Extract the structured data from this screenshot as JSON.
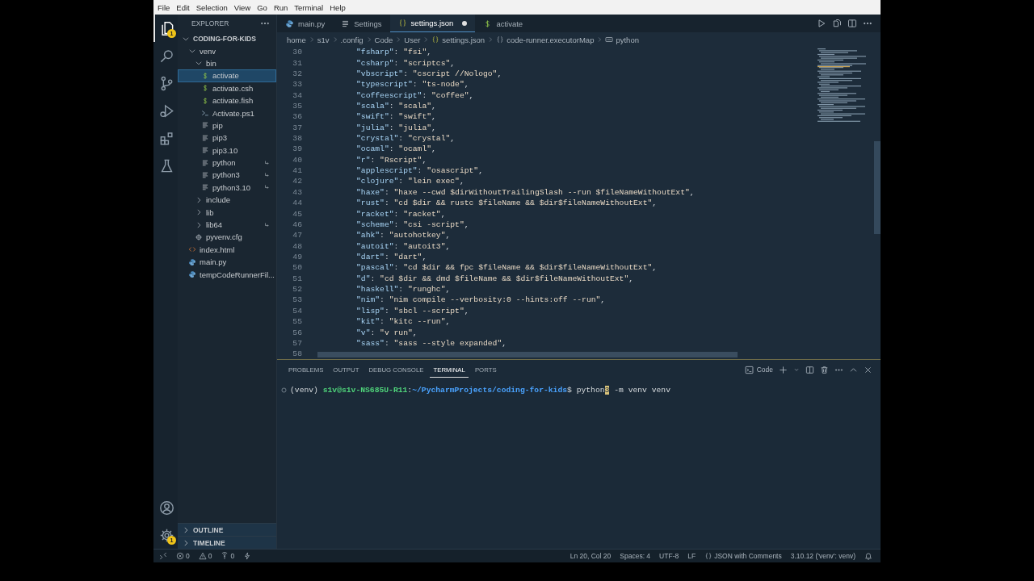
{
  "menu": [
    "File",
    "Edit",
    "Selection",
    "View",
    "Go",
    "Run",
    "Terminal",
    "Help"
  ],
  "activity_bar": {
    "top": [
      {
        "kind": "files",
        "selected": true,
        "badge": "1"
      },
      {
        "kind": "search",
        "selected": false
      },
      {
        "kind": "branch",
        "selected": false
      },
      {
        "kind": "debug",
        "selected": false
      },
      {
        "kind": "extensions",
        "selected": false
      },
      {
        "kind": "flask",
        "selected": false
      }
    ],
    "bottom": [
      {
        "kind": "account"
      },
      {
        "kind": "gear",
        "badge": "1"
      }
    ]
  },
  "explorer": {
    "title": "EXPLORER",
    "root": {
      "label": "CODING-FOR-KIDS",
      "expanded": true,
      "children": [
        {
          "label": "venv",
          "kind": "folder",
          "expanded": true,
          "selected": false,
          "children": [
            {
              "label": "bin",
              "kind": "folder",
              "expanded": true,
              "selected": false,
              "children": [
                {
                  "label": "activate",
                  "kind": "shell",
                  "selected": true,
                  "symlink": false
                },
                {
                  "label": "activate.csh",
                  "kind": "shell",
                  "selected": false,
                  "symlink": false
                },
                {
                  "label": "activate.fish",
                  "kind": "shell",
                  "selected": false,
                  "symlink": false
                },
                {
                  "label": "Activate.ps1",
                  "kind": "powershell",
                  "selected": false,
                  "symlink": false
                },
                {
                  "label": "pip",
                  "kind": "file",
                  "selected": false,
                  "symlink": false
                },
                {
                  "label": "pip3",
                  "kind": "file",
                  "selected": false,
                  "symlink": false
                },
                {
                  "label": "pip3.10",
                  "kind": "file",
                  "selected": false,
                  "symlink": false
                },
                {
                  "label": "python",
                  "kind": "file",
                  "selected": false,
                  "symlink": true
                },
                {
                  "label": "python3",
                  "kind": "file",
                  "selected": false,
                  "symlink": true
                },
                {
                  "label": "python3.10",
                  "kind": "file",
                  "selected": false,
                  "symlink": true
                }
              ]
            },
            {
              "label": "include",
              "kind": "folder",
              "expanded": false,
              "selected": false,
              "symlink": false
            },
            {
              "label": "lib",
              "kind": "folder",
              "expanded": false,
              "selected": false,
              "symlink": false
            },
            {
              "label": "lib64",
              "kind": "folder",
              "expanded": false,
              "selected": false,
              "symlink": true
            },
            {
              "label": "pyvenv.cfg",
              "kind": "config",
              "selected": false,
              "symlink": false
            }
          ]
        },
        {
          "label": "index.html",
          "kind": "html",
          "selected": false,
          "symlink": false
        },
        {
          "label": "main.py",
          "kind": "python",
          "selected": false,
          "symlink": false
        },
        {
          "label": "tempCodeRunnerFil...",
          "kind": "python",
          "selected": false,
          "symlink": false
        }
      ]
    },
    "sections": [
      {
        "label": "OUTLINE",
        "expanded": false
      },
      {
        "label": "TIMELINE",
        "expanded": false
      }
    ]
  },
  "tabs": [
    {
      "label": "main.py",
      "kind": "python",
      "selected": false,
      "modified": false
    },
    {
      "label": "Settings",
      "kind": "lines",
      "selected": false,
      "modified": false
    },
    {
      "label": "settings.json",
      "kind": "braces",
      "selected": true,
      "modified": true
    },
    {
      "label": "activate",
      "kind": "shell",
      "selected": false,
      "modified": false
    }
  ],
  "editor_actions": [
    {
      "kind": "run"
    },
    {
      "kind": "document"
    },
    {
      "kind": "split"
    },
    {
      "kind": "more"
    }
  ],
  "breadcrumb": [
    {
      "text": "home"
    },
    {
      "text": "s1v"
    },
    {
      "text": ".config"
    },
    {
      "text": "Code"
    },
    {
      "text": "User"
    },
    {
      "text": "settings.json",
      "kind": "braces"
    },
    {
      "text": "code-runner.executorMap",
      "kind": "object"
    },
    {
      "text": "python",
      "kind": "string"
    }
  ],
  "lines": [
    {
      "n": "30",
      "key": "\"fsharp\"",
      "colon": ": ",
      "value": "\"fsi\"",
      "comma": ","
    },
    {
      "n": "31",
      "key": "\"csharp\"",
      "colon": ": ",
      "value": "\"scriptcs\"",
      "comma": ","
    },
    {
      "n": "32",
      "key": "\"vbscript\"",
      "colon": ": ",
      "value": "\"cscript //Nologo\"",
      "comma": ","
    },
    {
      "n": "33",
      "key": "\"typescript\"",
      "colon": ": ",
      "value": "\"ts-node\"",
      "comma": ","
    },
    {
      "n": "34",
      "key": "\"coffeescript\"",
      "colon": ": ",
      "value": "\"coffee\"",
      "comma": ","
    },
    {
      "n": "35",
      "key": "\"scala\"",
      "colon": ": ",
      "value": "\"scala\"",
      "comma": ","
    },
    {
      "n": "36",
      "key": "\"swift\"",
      "colon": ": ",
      "value": "\"swift\"",
      "comma": ","
    },
    {
      "n": "37",
      "key": "\"julia\"",
      "colon": ": ",
      "value": "\"julia\"",
      "comma": ","
    },
    {
      "n": "38",
      "key": "\"crystal\"",
      "colon": ": ",
      "value": "\"crystal\"",
      "comma": ","
    },
    {
      "n": "39",
      "key": "\"ocaml\"",
      "colon": ": ",
      "value": "\"ocaml\"",
      "comma": ","
    },
    {
      "n": "40",
      "key": "\"r\"",
      "colon": ": ",
      "value": "\"Rscript\"",
      "comma": ","
    },
    {
      "n": "41",
      "key": "\"applescript\"",
      "colon": ": ",
      "value": "\"osascript\"",
      "comma": ","
    },
    {
      "n": "42",
      "key": "\"clojure\"",
      "colon": ": ",
      "value": "\"lein exec\"",
      "comma": ","
    },
    {
      "n": "43",
      "key": "\"haxe\"",
      "colon": ": ",
      "value": "\"haxe --cwd $dirWithoutTrailingSlash --run $fileNameWithoutExt\"",
      "comma": ","
    },
    {
      "n": "44",
      "key": "\"rust\"",
      "colon": ": ",
      "value": "\"cd $dir && rustc $fileName && $dir$fileNameWithoutExt\"",
      "comma": ","
    },
    {
      "n": "45",
      "key": "\"racket\"",
      "colon": ": ",
      "value": "\"racket\"",
      "comma": ","
    },
    {
      "n": "46",
      "key": "\"scheme\"",
      "colon": ": ",
      "value": "\"csi -script\"",
      "comma": ","
    },
    {
      "n": "47",
      "key": "\"ahk\"",
      "colon": ": ",
      "value": "\"autohotkey\"",
      "comma": ","
    },
    {
      "n": "48",
      "key": "\"autoit\"",
      "colon": ": ",
      "value": "\"autoit3\"",
      "comma": ","
    },
    {
      "n": "49",
      "key": "\"dart\"",
      "colon": ": ",
      "value": "\"dart\"",
      "comma": ","
    },
    {
      "n": "50",
      "key": "\"pascal\"",
      "colon": ": ",
      "value": "\"cd $dir && fpc $fileName && $dir$fileNameWithoutExt\"",
      "comma": ","
    },
    {
      "n": "51",
      "key": "\"d\"",
      "colon": ": ",
      "value": "\"cd $dir && dmd $fileName && $dir$fileNameWithoutExt\"",
      "comma": ","
    },
    {
      "n": "52",
      "key": "\"haskell\"",
      "colon": ": ",
      "value": "\"runghc\"",
      "comma": ","
    },
    {
      "n": "53",
      "key": "\"nim\"",
      "colon": ": ",
      "value": "\"nim compile --verbosity:0 --hints:off --run\"",
      "comma": ","
    },
    {
      "n": "54",
      "key": "\"lisp\"",
      "colon": ": ",
      "value": "\"sbcl --script\"",
      "comma": ","
    },
    {
      "n": "55",
      "key": "\"kit\"",
      "colon": ": ",
      "value": "\"kitc --run\"",
      "comma": ","
    },
    {
      "n": "56",
      "key": "\"v\"",
      "colon": ": ",
      "value": "\"v run\"",
      "comma": ","
    },
    {
      "n": "57",
      "key": "\"sass\"",
      "colon": ": ",
      "value": "\"sass --style expanded\"",
      "comma": ","
    },
    {
      "n": "58"
    }
  ],
  "panel": {
    "tabs": [
      {
        "label": "PROBLEMS",
        "selected": false
      },
      {
        "label": "OUTPUT",
        "selected": false
      },
      {
        "label": "DEBUG CONSOLE",
        "selected": false
      },
      {
        "label": "TERMINAL",
        "selected": true
      },
      {
        "label": "PORTS",
        "selected": false
      }
    ],
    "actions": [
      {
        "kind": "terminal",
        "text": "Code"
      },
      {
        "kind": "plus"
      },
      {
        "kind": "caret"
      },
      {
        "kind": "split"
      },
      {
        "kind": "trash"
      },
      {
        "kind": "more"
      },
      {
        "kind": "up"
      },
      {
        "kind": "close"
      }
    ],
    "terminal": [
      {
        "kind": "plain",
        "text": "(venv) "
      },
      {
        "kind": "user",
        "text": "s1v@s1v-NS685U-R11"
      },
      {
        "kind": "plain",
        "text": ":"
      },
      {
        "kind": "path",
        "text": "~/PycharmProjects/coding-for-kids"
      },
      {
        "kind": "plain",
        "text": "$ python"
      },
      {
        "kind": "cursor",
        "text": "3"
      },
      {
        "kind": "plain",
        "text": " -m venv venv"
      }
    ]
  },
  "status_bar": {
    "left": [
      {
        "kind": "remote"
      },
      {
        "kind": "errors",
        "text": "0"
      },
      {
        "kind": "warnings",
        "text": "0"
      },
      {
        "kind": "ports",
        "text": "0"
      },
      {
        "kind": "flash"
      }
    ],
    "right": [
      {
        "kind": "text",
        "text": "Ln 20, Col 20"
      },
      {
        "kind": "text",
        "text": "Spaces: 4"
      },
      {
        "kind": "text",
        "text": "UTF-8"
      },
      {
        "kind": "text",
        "text": "LF"
      },
      {
        "kind": "language",
        "text": "JSON with Comments"
      },
      {
        "kind": "text",
        "text": "3.10.12 ('venv': venv)"
      },
      {
        "kind": "bell"
      }
    ]
  }
}
